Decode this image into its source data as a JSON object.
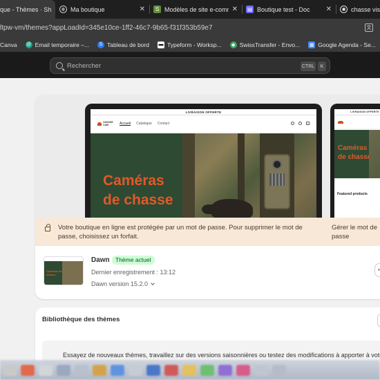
{
  "browser": {
    "tabs": [
      {
        "title": "que - Thèmes · Sh",
        "active": true,
        "icon": "shopify-icon"
      },
      {
        "title": "Ma boutique",
        "active": false,
        "icon": "globe-icon"
      },
      {
        "title": "Modèles de site e-comme",
        "active": false,
        "icon": "shopify-icon"
      },
      {
        "title": "Boutique test - Doc",
        "active": false,
        "icon": "docs-icon"
      },
      {
        "title": "chasse visio",
        "active": false,
        "icon": "chatgpt-icon"
      }
    ],
    "url": "ltpw-vm/themes?appLoadId=345e10ce-1ff2-46c7-9b65-f31f353b59e7",
    "bookmarks": [
      {
        "label": "Canva",
        "icon": "canva-icon"
      },
      {
        "label": "Email temporaire –...",
        "icon": "email-icon"
      },
      {
        "label": "Tableau de bord",
        "icon": "s-icon"
      },
      {
        "label": "Typeform - Worksp...",
        "icon": "typeform-icon"
      },
      {
        "label": "SwissTransfer - Envo...",
        "icon": "swisstransfer-icon"
      },
      {
        "label": "Google Agenda - Se...",
        "icon": "calendar-icon"
      }
    ]
  },
  "shopify": {
    "search_placeholder": "Rechercher",
    "shortcut_ctrl": "CTRL",
    "shortcut_k": "K"
  },
  "preview": {
    "announcement": "LIVRAISON OFFERTE",
    "logo_text": "CHASSE CAM",
    "nav": [
      "Accueil",
      "Catalogue",
      "Contact"
    ],
    "hero_title_line1": "Caméras",
    "hero_title_line2": "de chasse",
    "mobile_announcement": "LIVRAISON OFFERTE",
    "mobile_title_line1": "Caméras",
    "mobile_title_line2": "de chasse",
    "mobile_featured": "Featured products"
  },
  "banner": {
    "text": "Votre boutique en ligne est protégée par un mot de passe. Pour supprimer le mot de passe, choisissez un forfait.",
    "link": "Gérer le mot de passe"
  },
  "theme": {
    "name": "Dawn",
    "badge": "Thème actuel",
    "saved": "Dernier enregistrement : 13:12",
    "version": "Dawn version 15.2.0",
    "thumb_title": "Caméras de chasse"
  },
  "library": {
    "title": "Bibliothèque des thèmes",
    "text": "Essayez de nouveaux thèmes, travaillez sur des versions saisonnières ou testez des modifications à apporter à votre"
  },
  "colors": {
    "accent_orange": "#e2592a",
    "hero_green": "#2e4a32",
    "badge_green_bg": "#cdfed4",
    "banner_bg": "#f7e8d8"
  }
}
